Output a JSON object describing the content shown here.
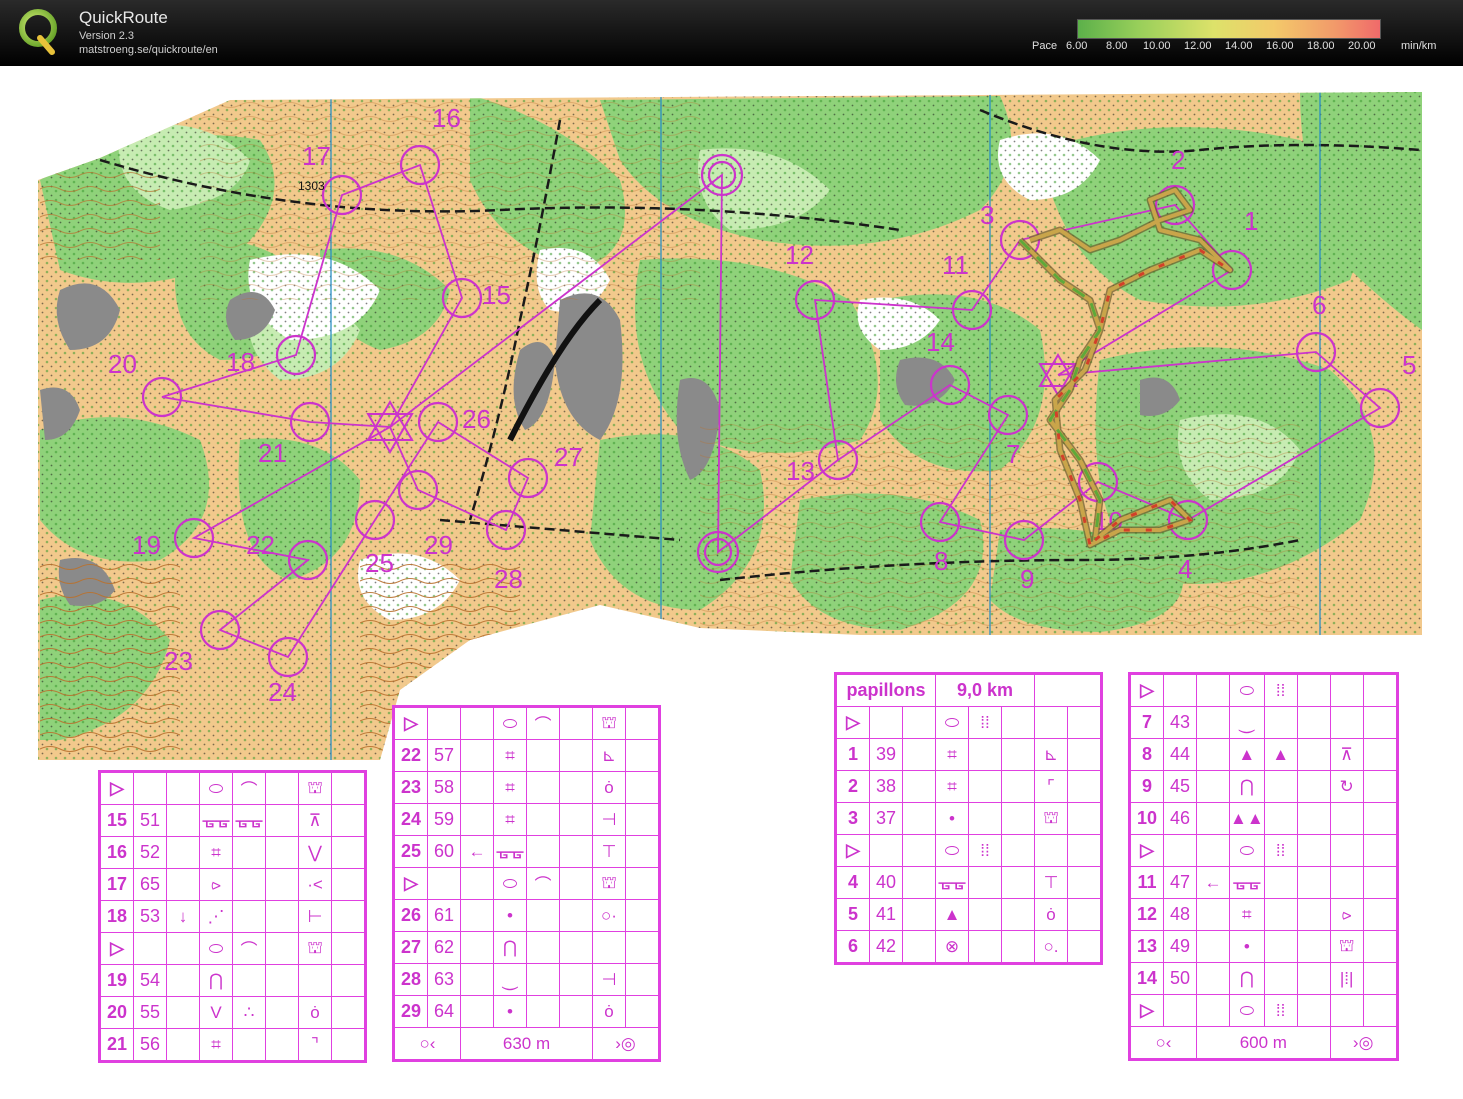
{
  "header": {
    "app_name": "QuickRoute",
    "version": "Version 2.3",
    "url": "matstroeng.se/quickroute/en",
    "pace_label": "Pace",
    "pace_ticks": [
      "6.00",
      "8.00",
      "10.00",
      "12.00",
      "14.00",
      "16.00",
      "18.00",
      "20.00"
    ],
    "pace_unit": "min/km",
    "logo_letter": "Q"
  },
  "map": {
    "features": [
      "orienteering-map",
      "course-controls",
      "gps-route"
    ],
    "controls": [
      {
        "n": "1"
      },
      {
        "n": "2"
      },
      {
        "n": "3"
      },
      {
        "n": "4"
      },
      {
        "n": "5"
      },
      {
        "n": "6"
      },
      {
        "n": "7"
      },
      {
        "n": "8"
      },
      {
        "n": "9"
      },
      {
        "n": "10"
      },
      {
        "n": "11"
      },
      {
        "n": "12"
      },
      {
        "n": "13"
      },
      {
        "n": "14"
      },
      {
        "n": "15"
      },
      {
        "n": "16"
      },
      {
        "n": "17"
      },
      {
        "n": "18"
      },
      {
        "n": "19"
      },
      {
        "n": "20"
      },
      {
        "n": "21"
      },
      {
        "n": "22"
      },
      {
        "n": "23"
      },
      {
        "n": "24"
      },
      {
        "n": "25"
      },
      {
        "n": "26"
      },
      {
        "n": "27"
      },
      {
        "n": "28"
      },
      {
        "n": "29"
      }
    ],
    "spot_height": "1303"
  },
  "cards": {
    "a": {
      "header_symbols": [
        "▷",
        "",
        "",
        "⬭",
        "⌒",
        "",
        "⛫",
        ""
      ],
      "rows": [
        [
          "15",
          "51",
          "",
          "ᚗᚗ",
          "ᚗᚗ",
          "",
          "⊼",
          ""
        ],
        [
          "16",
          "52",
          "",
          "⌗",
          "",
          "",
          "⋁",
          ""
        ],
        [
          "17",
          "65",
          "",
          "⪧",
          "",
          "",
          "·<",
          ""
        ],
        [
          "18",
          "53",
          "↓",
          "⋰",
          "",
          "",
          "⊢",
          ""
        ],
        [
          "▷",
          "",
          "",
          "⬭",
          "⌒",
          "",
          "⛫",
          ""
        ],
        [
          "19",
          "54",
          "",
          "⋂",
          "",
          "",
          "",
          ""
        ],
        [
          "20",
          "55",
          "",
          "V",
          "∴",
          "",
          "ȯ",
          ""
        ],
        [
          "21",
          "56",
          "",
          "⌗",
          "",
          "",
          "⌝",
          ""
        ]
      ]
    },
    "b": {
      "header_symbols": [
        "▷",
        "",
        "",
        "⬭",
        "⌒",
        "",
        "⛫",
        ""
      ],
      "rows": [
        [
          "22",
          "57",
          "",
          "⌗",
          "",
          "",
          "⊾",
          ""
        ],
        [
          "23",
          "58",
          "",
          "⌗",
          "",
          "",
          "ȯ",
          ""
        ],
        [
          "24",
          "59",
          "",
          "⌗",
          "",
          "",
          "⊣",
          ""
        ],
        [
          "25",
          "60",
          "←",
          "ᚗᚗ",
          "",
          "",
          "⊤",
          ""
        ],
        [
          "▷",
          "",
          "",
          "⬭",
          "⌒",
          "",
          "⛫",
          ""
        ],
        [
          "26",
          "61",
          "",
          "•",
          "",
          "",
          "○·",
          ""
        ],
        [
          "27",
          "62",
          "",
          "⋂",
          "",
          "",
          "",
          ""
        ],
        [
          "28",
          "63",
          "",
          "⏝",
          "",
          "",
          "⊣",
          ""
        ],
        [
          "29",
          "64",
          "",
          "•",
          "",
          "",
          "ȯ",
          ""
        ]
      ],
      "footer_distance": "630 m"
    },
    "c": {
      "title": "papillons",
      "distance": "9,0 km",
      "header_symbols": [
        "▷",
        "",
        "",
        "⬭",
        "⁞⁞",
        "",
        "",
        ""
      ],
      "rows": [
        [
          "1",
          "39",
          "",
          "⌗",
          "",
          "",
          "⊾",
          ""
        ],
        [
          "2",
          "38",
          "",
          "⌗",
          "",
          "",
          "⌜",
          ""
        ],
        [
          "3",
          "37",
          "",
          "•",
          "",
          "",
          "⛫",
          ""
        ],
        [
          "▷",
          "",
          "",
          "⬭",
          "⁞⁞",
          "",
          "",
          ""
        ],
        [
          "4",
          "40",
          "",
          "ᚗᚗ",
          "",
          "",
          "⊤",
          ""
        ],
        [
          "5",
          "41",
          "",
          "▲",
          "",
          "",
          "ȯ",
          ""
        ],
        [
          "6",
          "42",
          "",
          "⊗",
          "",
          "",
          "○.",
          ""
        ]
      ]
    },
    "d": {
      "header_symbols": [
        "▷",
        "",
        "",
        "⬭",
        "⁞⁞",
        "",
        "",
        ""
      ],
      "rows": [
        [
          "7",
          "43",
          "",
          "⏝",
          "",
          "",
          "",
          ""
        ],
        [
          "8",
          "44",
          "",
          "▲",
          "▲",
          "",
          "⊼",
          ""
        ],
        [
          "9",
          "45",
          "",
          "⋂",
          "",
          "",
          "↻",
          ""
        ],
        [
          "10",
          "46",
          "",
          "▲▲",
          "",
          "",
          "",
          ""
        ],
        [
          "▷",
          "",
          "",
          "⬭",
          "⁞⁞",
          "",
          "",
          ""
        ],
        [
          "11",
          "47",
          "←",
          "ᚗᚗ",
          "",
          "",
          "",
          ""
        ],
        [
          "12",
          "48",
          "",
          "⌗",
          "",
          "",
          "⪧",
          ""
        ],
        [
          "13",
          "49",
          "",
          "•",
          "",
          "",
          "⛫",
          ""
        ],
        [
          "14",
          "50",
          "",
          "⋂",
          "",
          "",
          "|⁞|",
          ""
        ],
        [
          "▷",
          "",
          "",
          "⬭",
          "⁞⁞",
          "",
          "",
          ""
        ]
      ],
      "footer_distance": "600 m"
    }
  },
  "colors": {
    "course_magenta": "#cc33cc",
    "open_land": "#f2c98c",
    "forest": "#8fd27a",
    "forest_light": "#c7ecb2",
    "rock": "#8a8a8a",
    "contour": "#b0641e",
    "route_slow": "#d2402a",
    "route_fast": "#5fa83a",
    "header_bg": "#000000"
  }
}
